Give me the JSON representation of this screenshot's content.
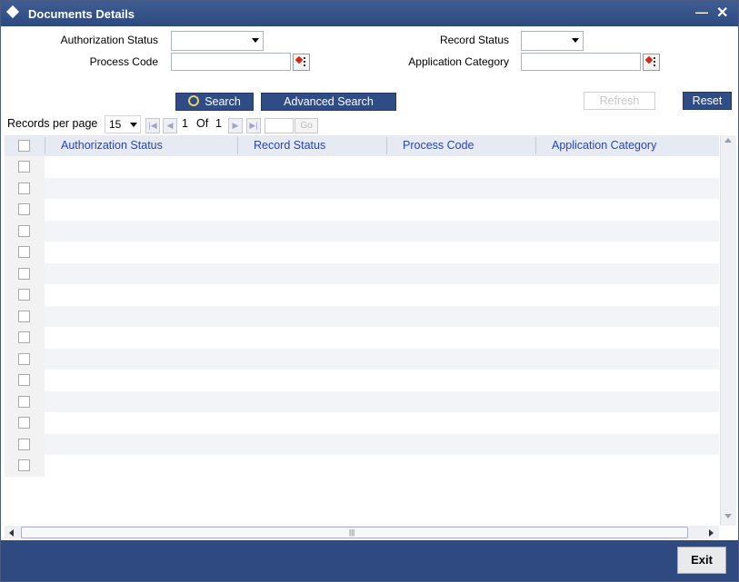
{
  "window": {
    "title": "Documents Details"
  },
  "form": {
    "authorization_status_label": "Authorization Status",
    "record_status_label": "Record Status",
    "process_code_label": "Process Code",
    "application_category_label": "Application Category",
    "authorization_status_value": "",
    "record_status_value": "",
    "process_code_value": "",
    "application_category_value": ""
  },
  "toolbar": {
    "search_label": "Search",
    "advanced_search_label": "Advanced Search",
    "refresh_label": "Refresh",
    "reset_label": "Reset"
  },
  "pager": {
    "records_per_page_label": "Records per page",
    "records_per_page_value": "15",
    "current_page": "1",
    "of_label": "Of",
    "total_pages": "1",
    "go_label": "Go"
  },
  "grid": {
    "columns": [
      "Authorization Status",
      "Record Status",
      "Process Code",
      "Application Category"
    ],
    "row_count": 15
  },
  "footer": {
    "exit_label": "Exit"
  },
  "colors": {
    "title_bar": "#2c4a80",
    "button": "#2f4c86",
    "header_text": "#2343cf"
  }
}
